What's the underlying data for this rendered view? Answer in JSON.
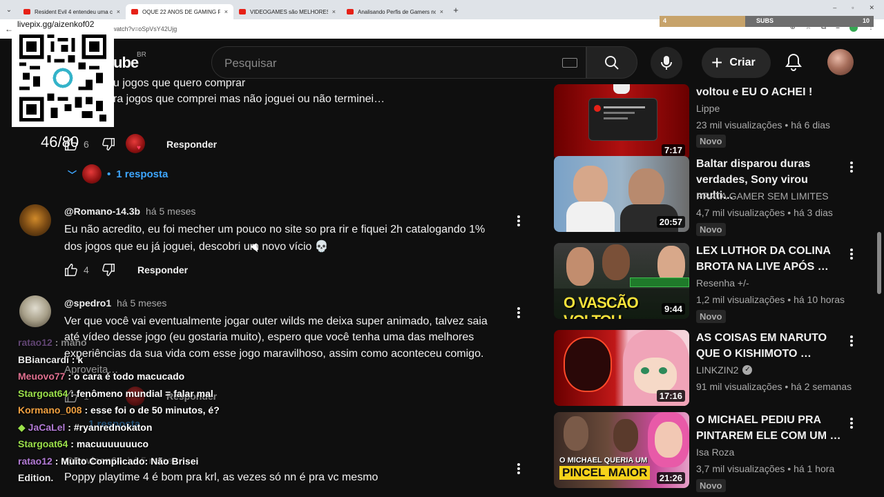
{
  "browser": {
    "tabs": [
      {
        "title": "Resident Evil 4 entendeu uma c",
        "active": false
      },
      {
        "title": "OQUE 22 ANOS DE GAMING FA",
        "active": true
      },
      {
        "title": "VIDEOGAMES são MELHORES",
        "active": false
      },
      {
        "title": "Analisando Perfis de Gamers no",
        "active": false
      }
    ],
    "url": "watch?v=oSpVsY42Ujg",
    "new_tab": "+",
    "close": "×",
    "window_controls": [
      "–",
      "▫",
      "✕"
    ]
  },
  "overlay": {
    "qr_label": "livepix.gg/aizenkof02",
    "counter": "46/80",
    "subs_label": "SUBS",
    "subs_current": "4",
    "subs_goal": "10",
    "subs_fraction": 0.4
  },
  "youtube": {
    "logo_fragment": "ube",
    "region": "BR",
    "search_placeholder": "Pesquisar",
    "create_label": "Criar"
  },
  "comments": {
    "partial": {
      "line1": "u jogos que quero comprar",
      "line2": "ra jogos que comprei mas não joguei ou não terminei…",
      "likes": "6",
      "respond": "Responder",
      "replies": "1 resposta"
    },
    "items": [
      {
        "author": "@Romano-14.3b",
        "when": "há 5 meses",
        "lines": [
          "Eu não acredito, eu foi mecher um pouco no site so pra rir e fiquei 2h catalogando 1%",
          "dos jogos que eu já joguei, descobri um novo vício 💀"
        ],
        "likes": "4",
        "respond": "Responder"
      },
      {
        "author": "@spedro1",
        "when": "há 5 meses",
        "lines": [
          "Ver que você vai eventualmente jogar outer wilds me deixa super animado, talvez saia",
          "até vídeo desse jogo (eu gostaria muito), espero que você tenha uma das melhores",
          "experiências da sua vida com esse jogo maravilhoso, assim como aconteceu comigo.",
          "Aproveita…"
        ],
        "likes": "1",
        "respond": "Responder",
        "replies": "1 resposta"
      },
      {
        "author": "@Davison64",
        "when": "há 5 meses",
        "lines": [
          "Poppy playtime 4 é bom pra krl, as vezes só nn é pra vc mesmo"
        ]
      }
    ]
  },
  "chat": [
    {
      "user": "ratao12",
      "msg": "mano",
      "color": "#b37bd6"
    },
    {
      "user": "BBiancardi",
      "msg": "k",
      "color": "#e8e8e8"
    },
    {
      "user": "Meuovo77",
      "msg": "o cara é todo macucado",
      "color": "#e07090"
    },
    {
      "user": "Stargoat64",
      "msg": "fenômeno mundial = falar mal",
      "color": "#9be04a"
    },
    {
      "user": "Kormano_008",
      "msg": "esse foi o de 50 minutos, é?",
      "color": "#f0a040"
    },
    {
      "user": "JaCaLel",
      "msg": "#ryanrednokaton",
      "color": "#b37bd6"
    },
    {
      "user": "Stargoat64",
      "msg": "macuuuuuuuco",
      "color": "#9be04a"
    },
    {
      "user": "ratao12",
      "msg": "Muito Complicado: Não Brisei",
      "color": "#b37bd6"
    },
    {
      "user": "Edition.",
      "msg": "",
      "color": "#e8e8e8"
    }
  ],
  "sidebar": [
    {
      "title": "voltou e EU O ACHEI !",
      "channel": "Lippe",
      "views": "23 mil visualizações",
      "age": "há 6 dias",
      "duration": "7:17",
      "badge": "Novo",
      "verified": false
    },
    {
      "title": "Baltar disparou duras verdades, Sony virou multi…",
      "channel": "PRATA GAMER SEM LIMITES",
      "views": "4,7 mil visualizações",
      "age": "há 3 dias",
      "duration": "20:57",
      "badge": "Novo",
      "verified": false
    },
    {
      "title": "LEX LUTHOR DA COLINA BROTA NA LIVE APÓS …",
      "channel": "Resenha +/-",
      "views": "1,2 mil visualizações",
      "age": "há 10 horas",
      "duration": "9:44",
      "badge": "Novo",
      "verified": false,
      "thumb_text": "O VASCÃO VOLTOU"
    },
    {
      "title": "AS COISAS EM NARUTO QUE O KISHIMOTO …",
      "channel": "LINKZIN2",
      "views": "91 mil visualizações",
      "age": "há 2 semanas",
      "duration": "17:16",
      "badge": "",
      "verified": true
    },
    {
      "title": "O MICHAEL PEDIU PRA PINTAREM ELE COM UM …",
      "channel": "Isa Roza",
      "views": "3,7 mil visualizações",
      "age": "há 1 hora",
      "duration": "21:26",
      "badge": "Novo",
      "verified": false,
      "thumb_text_1": "O MICHAEL QUERIA UM",
      "thumb_text_2": "PINCEL MAIOR"
    }
  ]
}
